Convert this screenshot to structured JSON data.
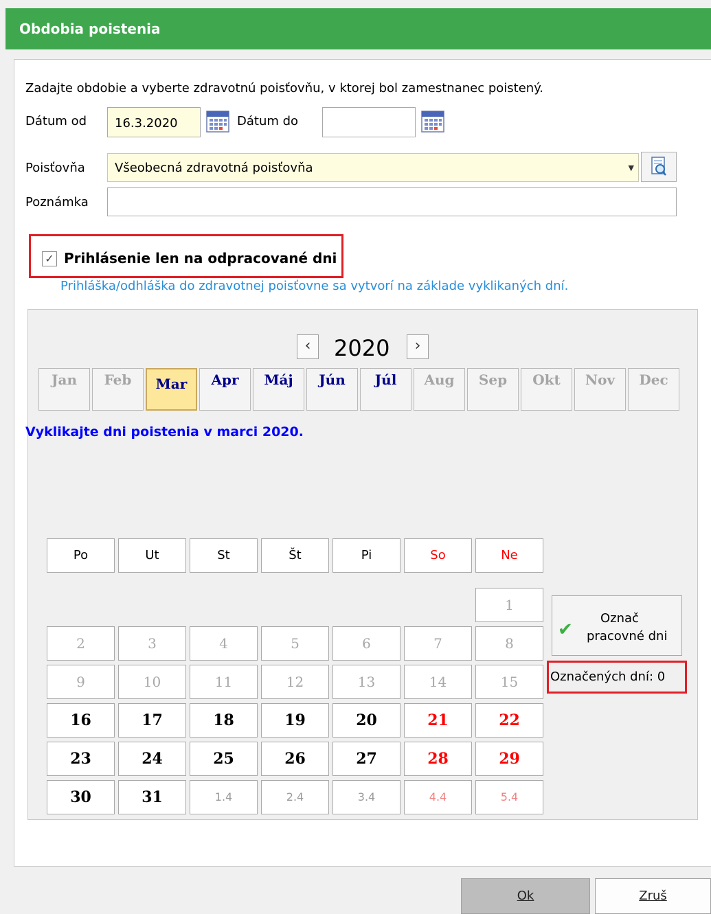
{
  "window": {
    "title": "Obdobia poistenia"
  },
  "form": {
    "instruction": "Zadajte obdobie a vyberte zdravotnú poisťovňu, v ktorej bol zamestnanec poistený.",
    "date_from_label": "Dátum od",
    "date_from_value": "16.3.2020",
    "date_to_label": "Dátum do",
    "date_to_value": "",
    "insurer_label": "Poisťovňa",
    "insurer_value": "Všeobecná zdravotná poisťovňa",
    "note_label": "Poznámka",
    "note_value": "",
    "checkbox_label": "Prihlásenie len na odpracované dni",
    "checkbox_checked": true,
    "hint": "Prihláška/odhláška do zdravotnej poisťovne sa vytvorí na základe vyklikaných dní."
  },
  "calendar": {
    "year": "2020",
    "months": [
      {
        "label": "Jan",
        "active": false
      },
      {
        "label": "Feb",
        "active": false
      },
      {
        "label": "Mar",
        "active": true,
        "current": true
      },
      {
        "label": "Apr",
        "active": true
      },
      {
        "label": "Máj",
        "active": true
      },
      {
        "label": "Jún",
        "active": true
      },
      {
        "label": "Júl",
        "active": true
      },
      {
        "label": "Aug",
        "active": false
      },
      {
        "label": "Sep",
        "active": false
      },
      {
        "label": "Okt",
        "active": false
      },
      {
        "label": "Nov",
        "active": false
      },
      {
        "label": "Dec",
        "active": false
      }
    ],
    "message": "Vyklikajte dni poistenia v marci 2020.",
    "weekdays": [
      "Po",
      "Ut",
      "St",
      "Št",
      "Pi",
      "So",
      "Ne"
    ],
    "weeks": [
      [
        null,
        null,
        null,
        null,
        null,
        null,
        {
          "label": "1",
          "state": "dis"
        }
      ],
      [
        {
          "label": "2",
          "state": "dis"
        },
        {
          "label": "3",
          "state": "dis"
        },
        {
          "label": "4",
          "state": "dis"
        },
        {
          "label": "5",
          "state": "dis"
        },
        {
          "label": "6",
          "state": "dis"
        },
        {
          "label": "7",
          "state": "dis"
        },
        {
          "label": "8",
          "state": "dis"
        }
      ],
      [
        {
          "label": "9",
          "state": "dis"
        },
        {
          "label": "10",
          "state": "dis"
        },
        {
          "label": "11",
          "state": "dis"
        },
        {
          "label": "12",
          "state": "dis"
        },
        {
          "label": "13",
          "state": "dis"
        },
        {
          "label": "14",
          "state": "dis"
        },
        {
          "label": "15",
          "state": "dis"
        }
      ],
      [
        {
          "label": "16",
          "state": "act"
        },
        {
          "label": "17",
          "state": "act"
        },
        {
          "label": "18",
          "state": "act"
        },
        {
          "label": "19",
          "state": "act"
        },
        {
          "label": "20",
          "state": "act"
        },
        {
          "label": "21",
          "state": "act"
        },
        {
          "label": "22",
          "state": "act"
        }
      ],
      [
        {
          "label": "23",
          "state": "act"
        },
        {
          "label": "24",
          "state": "act"
        },
        {
          "label": "25",
          "state": "act"
        },
        {
          "label": "26",
          "state": "act"
        },
        {
          "label": "27",
          "state": "act"
        },
        {
          "label": "28",
          "state": "act"
        },
        {
          "label": "29",
          "state": "act"
        }
      ],
      [
        {
          "label": "30",
          "state": "act"
        },
        {
          "label": "31",
          "state": "act"
        },
        {
          "label": "1.4",
          "state": "next"
        },
        {
          "label": "2.4",
          "state": "next"
        },
        {
          "label": "3.4",
          "state": "next"
        },
        {
          "label": "4.4",
          "state": "next"
        },
        {
          "label": "5.4",
          "state": "next"
        }
      ]
    ],
    "mark_button_line1": "Označ",
    "mark_button_line2": "pracovné dni",
    "marked_count_text": "Označených dní: 0"
  },
  "buttons": {
    "ok": "Ok",
    "cancel": "Zruš"
  },
  "colors": {
    "title_bar": "#3fa84f",
    "highlight": "#e21f26",
    "hint": "#2a8fd8",
    "weekend": "#ff0000",
    "current_month": "#fde79a"
  }
}
